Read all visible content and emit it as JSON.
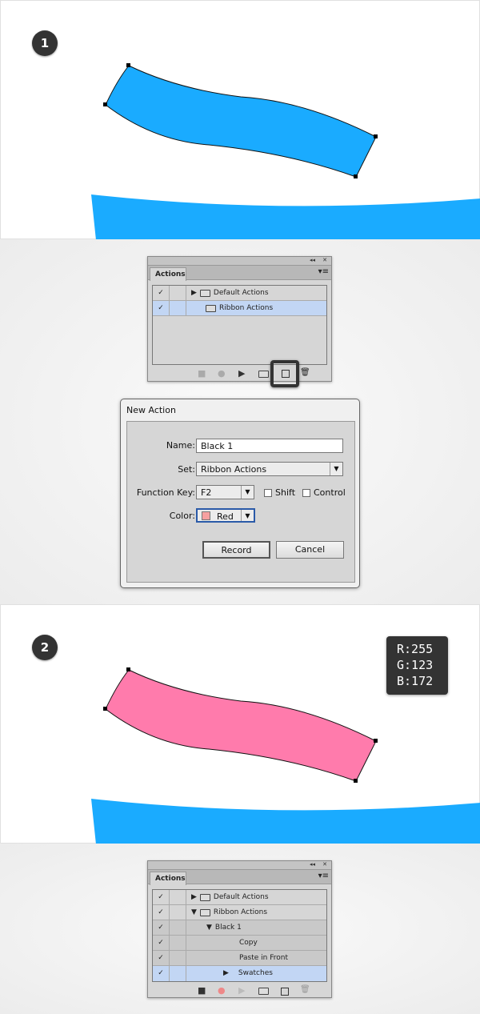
{
  "step1": {
    "number": "1",
    "shape_color": "#1aabff"
  },
  "panel1": {
    "tab": "Actions",
    "rows": [
      {
        "check": "✓",
        "label": "Default Actions",
        "expand": "▶",
        "folder": true
      },
      {
        "check": "✓",
        "label": "Ribbon Actions",
        "expand": "",
        "folder": true,
        "selected": true
      }
    ],
    "highlighted_button": "new-action"
  },
  "dialog": {
    "title": "New Action",
    "name_label": "Name:",
    "name_value": "Black 1",
    "set_label": "Set:",
    "set_value": "Ribbon Actions",
    "fkey_label": "Function Key:",
    "fkey_value": "F2",
    "shift_label": "Shift",
    "control_label": "Control",
    "color_label": "Color:",
    "color_value": "Red",
    "color_swatch": "#f7a0a0",
    "record": "Record",
    "cancel": "Cancel"
  },
  "step2": {
    "number": "2",
    "shape_color": "#ff7bac",
    "rgb": {
      "r": "R:255",
      "g": "G:123",
      "b": "B:172"
    }
  },
  "panel2": {
    "tab": "Actions",
    "rows": [
      {
        "check": "✓",
        "label": "Default Actions",
        "expand": "▶"
      },
      {
        "check": "✓",
        "label": "Ribbon Actions",
        "expand": "▼"
      },
      {
        "check": "✓",
        "label": "Black 1",
        "expand": "▼"
      },
      {
        "check": "✓",
        "label": "Copy"
      },
      {
        "check": "✓",
        "label": "Paste in Front"
      },
      {
        "check": "✓",
        "label": "Swatches",
        "expand": "▶",
        "selected": true
      }
    ]
  },
  "panel_icons": {
    "collapse": "◂◂",
    "close": "✕",
    "menu": "▾≡",
    "stop": "■",
    "record": "●",
    "play": "▶",
    "new_set": "folder",
    "new_action": "new",
    "delete": "trash"
  }
}
